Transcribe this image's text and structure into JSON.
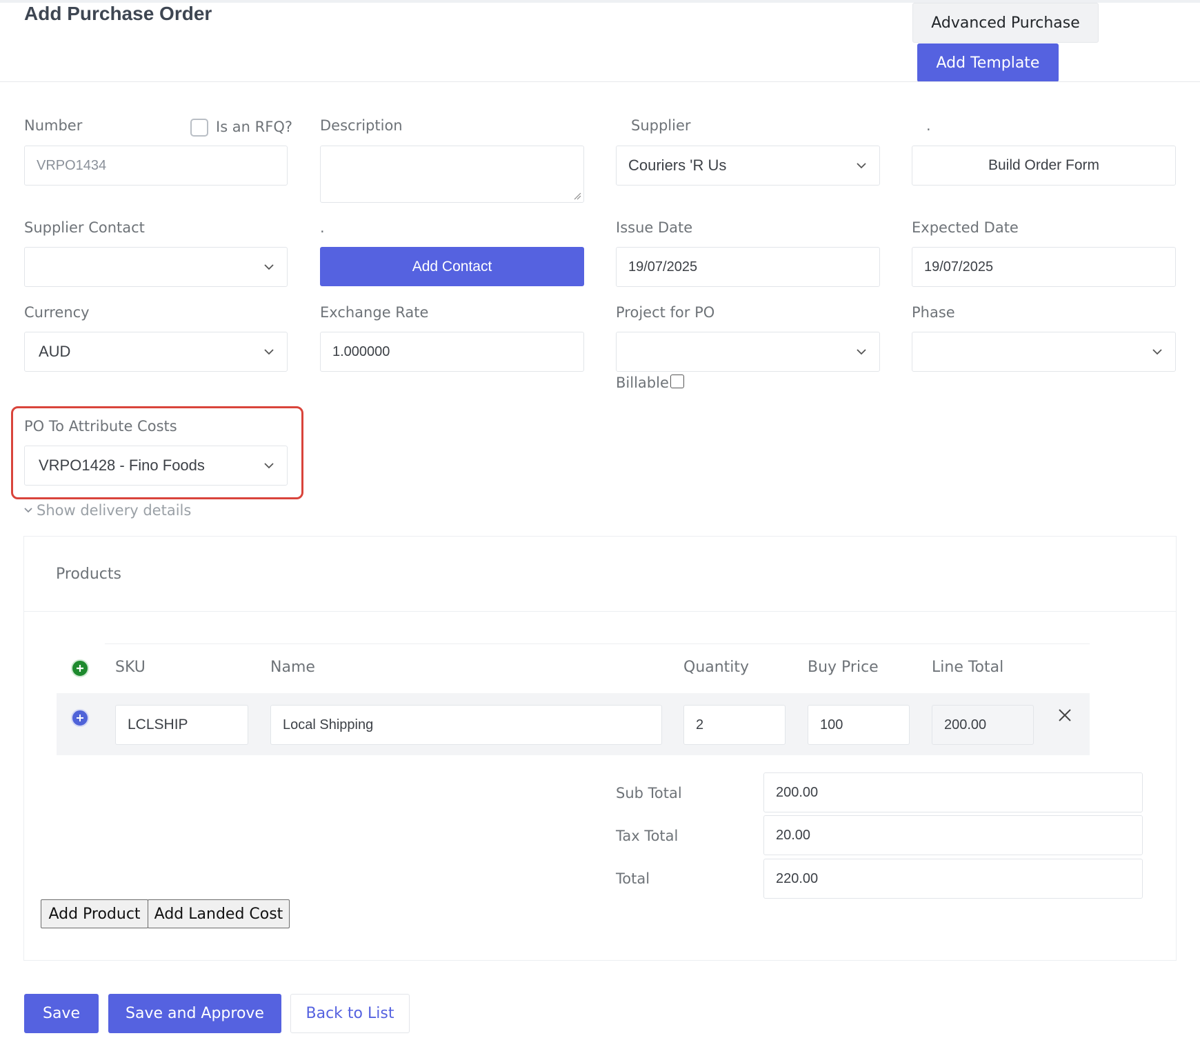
{
  "header": {
    "title": "Add Purchase Order",
    "advanced_purchase_label": "Advanced Purchase",
    "add_template_label": "Add Template"
  },
  "form": {
    "number": {
      "label": "Number",
      "value": "VRPO1434"
    },
    "rfq": {
      "label": "Is an RFQ?",
      "checked": false
    },
    "description": {
      "label": "Description",
      "value": ""
    },
    "supplier": {
      "label": "Supplier",
      "value": "Couriers 'R Us"
    },
    "build_order": {
      "label": ".",
      "button_label": "Build Order Form"
    },
    "supplier_contact": {
      "label": "Supplier Contact",
      "value": ""
    },
    "add_contact": {
      "label": ".",
      "button_label": "Add Contact"
    },
    "issue_date": {
      "label": "Issue Date",
      "value": "19/07/2025"
    },
    "expected_date": {
      "label": "Expected Date",
      "value": "19/07/2025"
    },
    "currency": {
      "label": "Currency",
      "value": "AUD"
    },
    "exchange_rate": {
      "label": "Exchange Rate",
      "value": "1.000000"
    },
    "project": {
      "label": "Project for PO",
      "value": ""
    },
    "billable": {
      "label": "Billable",
      "checked": false
    },
    "phase": {
      "label": "Phase",
      "value": ""
    },
    "po_attribute": {
      "label": "PO To Attribute Costs",
      "value": "VRPO1428 - Fino Foods"
    },
    "delivery_toggle": "Show delivery details"
  },
  "products": {
    "title": "Products",
    "columns": [
      "SKU",
      "Name",
      "Quantity",
      "Buy Price",
      "Line Total"
    ],
    "rows": [
      {
        "sku": "LCLSHIP",
        "name": "Local Shipping",
        "quantity": "2",
        "buy_price": "100",
        "line_total": "200.00"
      }
    ],
    "totals": {
      "sub_total_label": "Sub Total",
      "sub_total": "200.00",
      "tax_total_label": "Tax Total",
      "tax_total": "20.00",
      "total_label": "Total",
      "total": "220.00"
    },
    "add_product_label": "Add Product",
    "add_landed_cost_label": "Add Landed Cost"
  },
  "actions": {
    "save_label": "Save",
    "save_approve_label": "Save and Approve",
    "back_label": "Back to List"
  },
  "colors": {
    "primary": "#5562e0",
    "highlight": "#d9443b",
    "add_icon_green": "#1e8a2e",
    "row_icon_blue": "#4f63d8"
  },
  "icons": {
    "dropdown": "chevron-down-icon",
    "add_row": "plus-circle-icon",
    "remove_row": "close-icon"
  }
}
